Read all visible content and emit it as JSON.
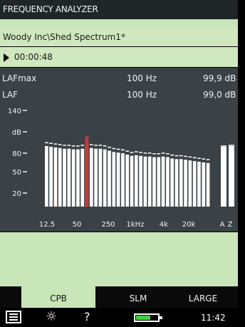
{
  "title": "FREQUENCY ANALYZER",
  "project_path": "Woody Inc\\Shed Spectrum1*",
  "elapsed_time": "00:00:48",
  "measurements": [
    {
      "name": "LAFmax",
      "freq": "100 Hz",
      "value": "99,9 dB"
    },
    {
      "name": "LAF",
      "freq": "100 Hz",
      "value": "99,0 dB"
    }
  ],
  "chart_data": {
    "type": "bar",
    "y_tick_labels": [
      "140",
      "dB",
      "80",
      "50",
      "20"
    ],
    "x_tick_labels": [
      "12.5",
      "50",
      "250",
      "1kHz",
      "4k",
      "20k",
      "A",
      "Z"
    ],
    "ylim": [
      0,
      150
    ],
    "values": [
      93,
      92,
      91,
      90,
      89,
      89,
      88,
      88,
      89,
      91,
      90,
      89,
      89,
      88,
      86,
      84,
      83,
      82,
      80,
      78,
      79,
      78,
      77,
      77,
      76,
      76,
      77,
      76,
      74,
      73,
      73,
      72,
      71,
      70,
      69,
      68,
      67
    ],
    "max_values": [
      99,
      98,
      97,
      96,
      95,
      95,
      94,
      94,
      95,
      97,
      96,
      95,
      95,
      94,
      92,
      90,
      89,
      88,
      86,
      84,
      85,
      84,
      83,
      83,
      82,
      82,
      83,
      82,
      80,
      79,
      79,
      78,
      77,
      76,
      75,
      74,
      73
    ],
    "cursor_index": 9,
    "cursor_value": 108,
    "broadband_values": [
      {
        "name": "A",
        "value": 92,
        "max": 94
      },
      {
        "name": "Z",
        "value": 93,
        "max": 95
      }
    ],
    "grid": false,
    "colors": {
      "bar": "#ffffff",
      "cursor": "#c93a3a",
      "max": "#ffffff",
      "background": "#3a4247"
    }
  },
  "tabs": [
    {
      "label": "CPB",
      "active": true
    },
    {
      "label": "SLM",
      "active": false
    },
    {
      "label": "LARGE",
      "active": false
    }
  ],
  "status": {
    "clock": "11:42",
    "battery_color": "#3ed13e"
  },
  "icons": [
    "menu-icon",
    "brightness-icon",
    "help-icon",
    "battery-icon"
  ]
}
